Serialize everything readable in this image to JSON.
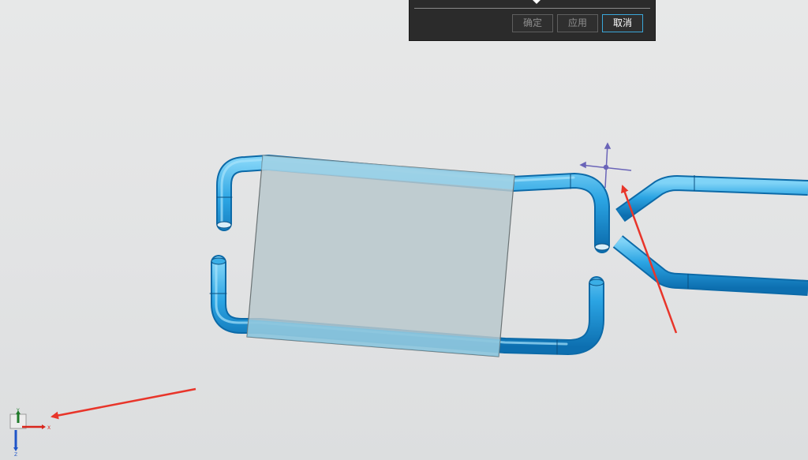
{
  "dialog": {
    "ok_label": "确定",
    "apply_label": "应用",
    "cancel_label": "取消",
    "collapse_icon": "triangle-down-icon"
  },
  "triad": {
    "y_label": "Y",
    "x_label": "X",
    "z_label": "Z"
  },
  "colors": {
    "pipe": "#2aa3e0",
    "selection_panel": "#b9c8cc",
    "annotation_arrow": "#e8352a",
    "dialog_bg": "#2b2b2b",
    "cancel_border": "#3aa6d8"
  }
}
